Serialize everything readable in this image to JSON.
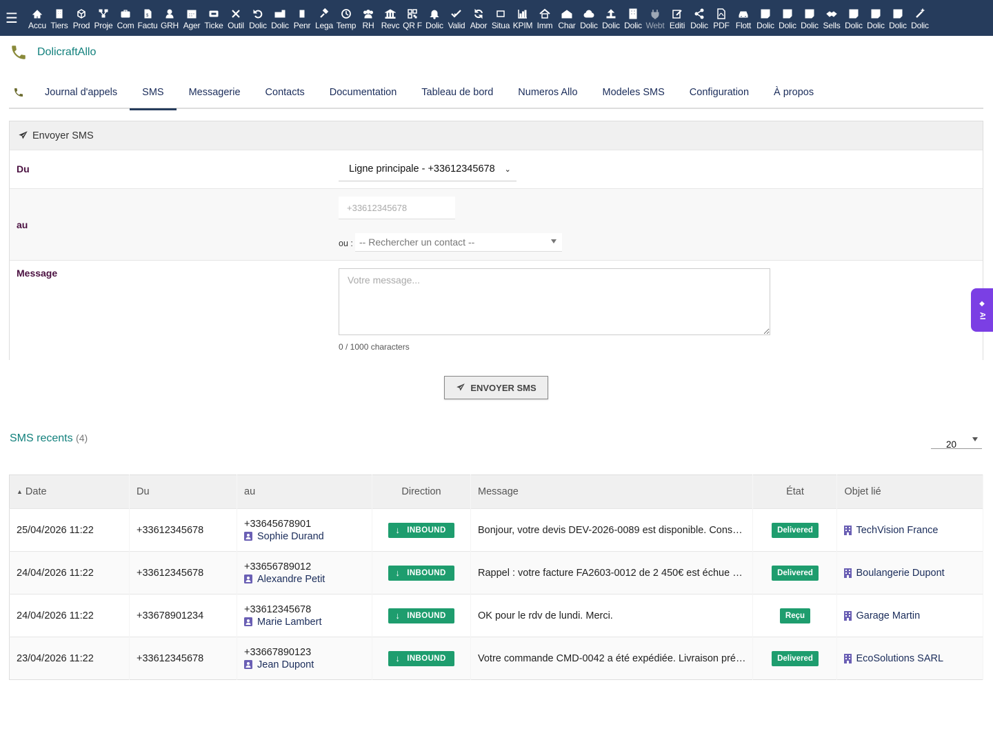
{
  "topbar": {
    "menu": [
      {
        "label": "Accu",
        "icon": "home-icon"
      },
      {
        "label": "Tiers",
        "icon": "building-icon"
      },
      {
        "label": "Prod",
        "icon": "cube-icon"
      },
      {
        "label": "Proje",
        "icon": "project-icon"
      },
      {
        "label": "Com",
        "icon": "briefcase-icon"
      },
      {
        "label": "Factu",
        "icon": "invoice-icon"
      },
      {
        "label": "GRH",
        "icon": "user-tie-icon"
      },
      {
        "label": "Ager",
        "icon": "calendar-icon"
      },
      {
        "label": "Ticke",
        "icon": "ticket-icon"
      },
      {
        "label": "Outil",
        "icon": "tools-icon"
      },
      {
        "label": "Dolic",
        "icon": "undo-icon"
      },
      {
        "label": "Dolic",
        "icon": "toolbox-icon"
      },
      {
        "label": "Penr",
        "icon": "bookmark-icon"
      },
      {
        "label": "Lega",
        "icon": "gavel-icon"
      },
      {
        "label": "Temp",
        "icon": "clock-icon"
      },
      {
        "label": "RH",
        "icon": "users-icon"
      },
      {
        "label": "Revc",
        "icon": "bank-icon"
      },
      {
        "label": "QR F",
        "icon": "qrcode-icon"
      },
      {
        "label": "Dolic",
        "icon": "bell-icon"
      },
      {
        "label": "Valid",
        "icon": "check-double-icon"
      },
      {
        "label": "Abor",
        "icon": "sync-icon"
      },
      {
        "label": "Situa",
        "icon": "situation-icon"
      },
      {
        "label": "KPIM",
        "icon": "chart-bar-icon"
      },
      {
        "label": "Imm",
        "icon": "house-icon"
      },
      {
        "label": "Char",
        "icon": "warehouse-icon"
      },
      {
        "label": "Dolic",
        "icon": "cloud-icon"
      },
      {
        "label": "Dolic",
        "icon": "upload-icon"
      },
      {
        "label": "Dolic",
        "icon": "office-building-icon"
      },
      {
        "label": "Webt",
        "icon": "plug-icon"
      },
      {
        "label": "Editi",
        "icon": "edit-icon"
      },
      {
        "label": "Dolic",
        "icon": "share-icon"
      },
      {
        "label": "PDF",
        "icon": "pdf-icon"
      },
      {
        "label": "Flott",
        "icon": "car-icon"
      },
      {
        "label": "Dolic",
        "icon": "note-icon"
      },
      {
        "label": "Dolic",
        "icon": "note-icon"
      },
      {
        "label": "Dolic",
        "icon": "note-icon"
      },
      {
        "label": "Sells",
        "icon": "handshake-icon"
      },
      {
        "label": "Dolic",
        "icon": "note-icon"
      },
      {
        "label": "Dolic",
        "icon": "note-icon"
      },
      {
        "label": "Dolic",
        "icon": "note-icon"
      },
      {
        "label": "Dolic",
        "icon": "magic-wand-icon"
      }
    ]
  },
  "module": {
    "title": "DolicraftAllo"
  },
  "tabs": [
    {
      "label": "Journal d'appels",
      "active": false
    },
    {
      "label": "SMS",
      "active": true
    },
    {
      "label": "Messagerie",
      "active": false
    },
    {
      "label": "Contacts",
      "active": false
    },
    {
      "label": "Documentation",
      "active": false
    },
    {
      "label": "Tableau de bord",
      "active": false
    },
    {
      "label": "Numeros Allo",
      "active": false
    },
    {
      "label": "Modeles SMS",
      "active": false
    },
    {
      "label": "Configuration",
      "active": false
    },
    {
      "label": "À propos",
      "active": false
    }
  ],
  "form": {
    "title": "Envoyer SMS",
    "from_label": "Du",
    "from_value": "Ligne principale - +33612345678",
    "to_label": "au",
    "to_placeholder": "+33612345678",
    "or_label": "ou :",
    "contact_placeholder": "-- Rechercher un contact --",
    "message_label": "Message",
    "message_placeholder": "Votre message...",
    "char_count": "0 / 1000 characters"
  },
  "send_button": "ENVOYER SMS",
  "recent": {
    "title": "SMS recents",
    "count": "(4)",
    "limit": "20",
    "columns": {
      "date": "Date",
      "from": "Du",
      "to": "au",
      "direction": "Direction",
      "message": "Message",
      "state": "État",
      "object": "Objet lié"
    },
    "rows": [
      {
        "date": "25/04/2026 11:22",
        "from": "+33612345678",
        "to": "+33645678901",
        "contact": "Sophie Durand",
        "direction": "INBOUND",
        "message": "Bonjour, votre devis DEV-2026-0089 est disponible. Cons…",
        "state": "Delivered",
        "object": "TechVision France"
      },
      {
        "date": "24/04/2026 11:22",
        "from": "+33612345678",
        "to": "+33656789012",
        "contact": "Alexandre Petit",
        "direction": "INBOUND",
        "message": "Rappel : votre facture FA2603-0012 de 2 450€ est échue …",
        "state": "Delivered",
        "object": "Boulangerie Dupont"
      },
      {
        "date": "24/04/2026 11:22",
        "from": "+33678901234",
        "to": "+33612345678",
        "contact": "Marie Lambert",
        "direction": "INBOUND",
        "message": "OK pour le rdv de lundi. Merci.",
        "state": "Reçu",
        "object": "Garage Martin"
      },
      {
        "date": "23/04/2026 11:22",
        "from": "+33612345678",
        "to": "+33667890123",
        "contact": "Jean Dupont",
        "direction": "INBOUND",
        "message": "Votre commande CMD-0042 a été expédiée. Livraison pré…",
        "state": "Delivered",
        "object": "EcoSolutions SARL"
      }
    ]
  },
  "ai_tab": {
    "label": "AI"
  },
  "colors": {
    "topbar": "#263c5c",
    "accent_teal": "#11807c",
    "badge_green": "#1e9d6e",
    "label_purple": "#4a1040",
    "ai_purple": "#7b3fe4",
    "phone_olive": "#8a8a3a"
  }
}
